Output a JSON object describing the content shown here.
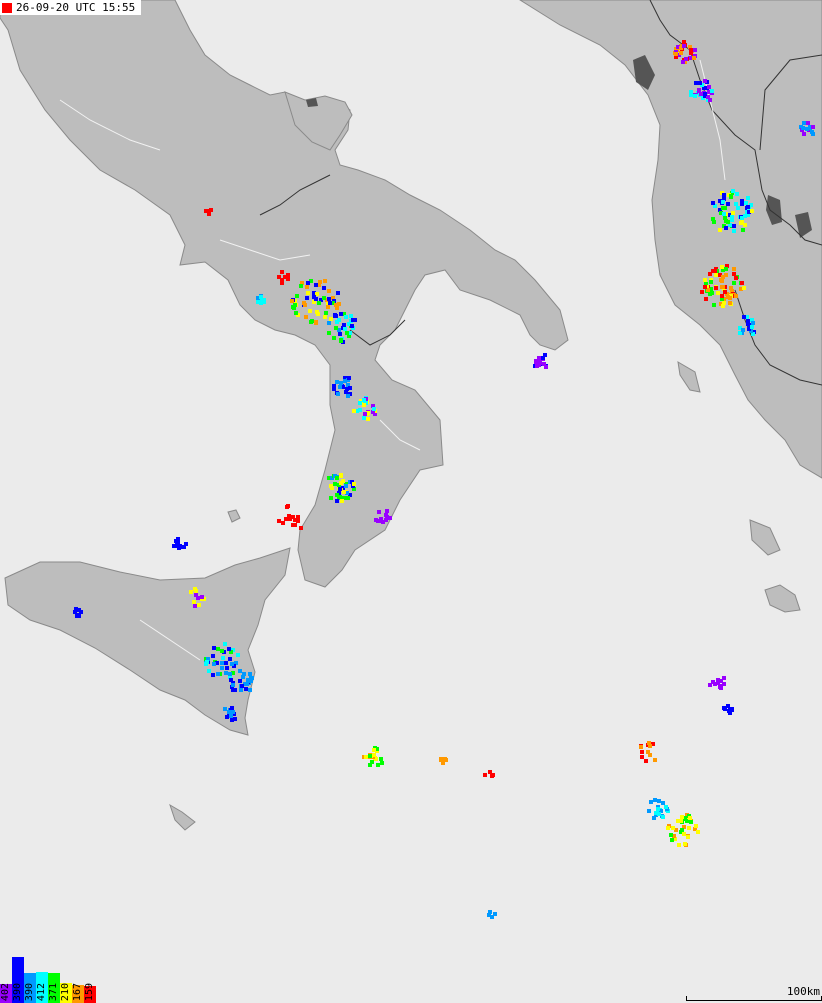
{
  "timestamp": {
    "text": "26-09-20 UTC 15:55",
    "marker_color": "#ff0000"
  },
  "scale": {
    "label": "100km"
  },
  "legend": [
    {
      "label": "402",
      "color": "#9900ff",
      "fill": 0.4
    },
    {
      "label": "390",
      "color": "#0000ff",
      "fill": 0.95
    },
    {
      "label": "390",
      "color": "#0099ff",
      "fill": 0.63
    },
    {
      "label": "412",
      "color": "#00ffff",
      "fill": 0.65
    },
    {
      "label": "371",
      "color": "#00ff00",
      "fill": 0.62
    },
    {
      "label": "210",
      "color": "#ffff00",
      "fill": 0.42
    },
    {
      "label": "167",
      "color": "#ff9900",
      "fill": 0.37
    },
    {
      "label": "159",
      "color": "#ff0000",
      "fill": 0.36
    }
  ],
  "colors": {
    "sea": "#ebebeb",
    "land": "#bdbdbd",
    "lake": "#555555",
    "border": "#333333",
    "river": "#ffffff"
  }
}
